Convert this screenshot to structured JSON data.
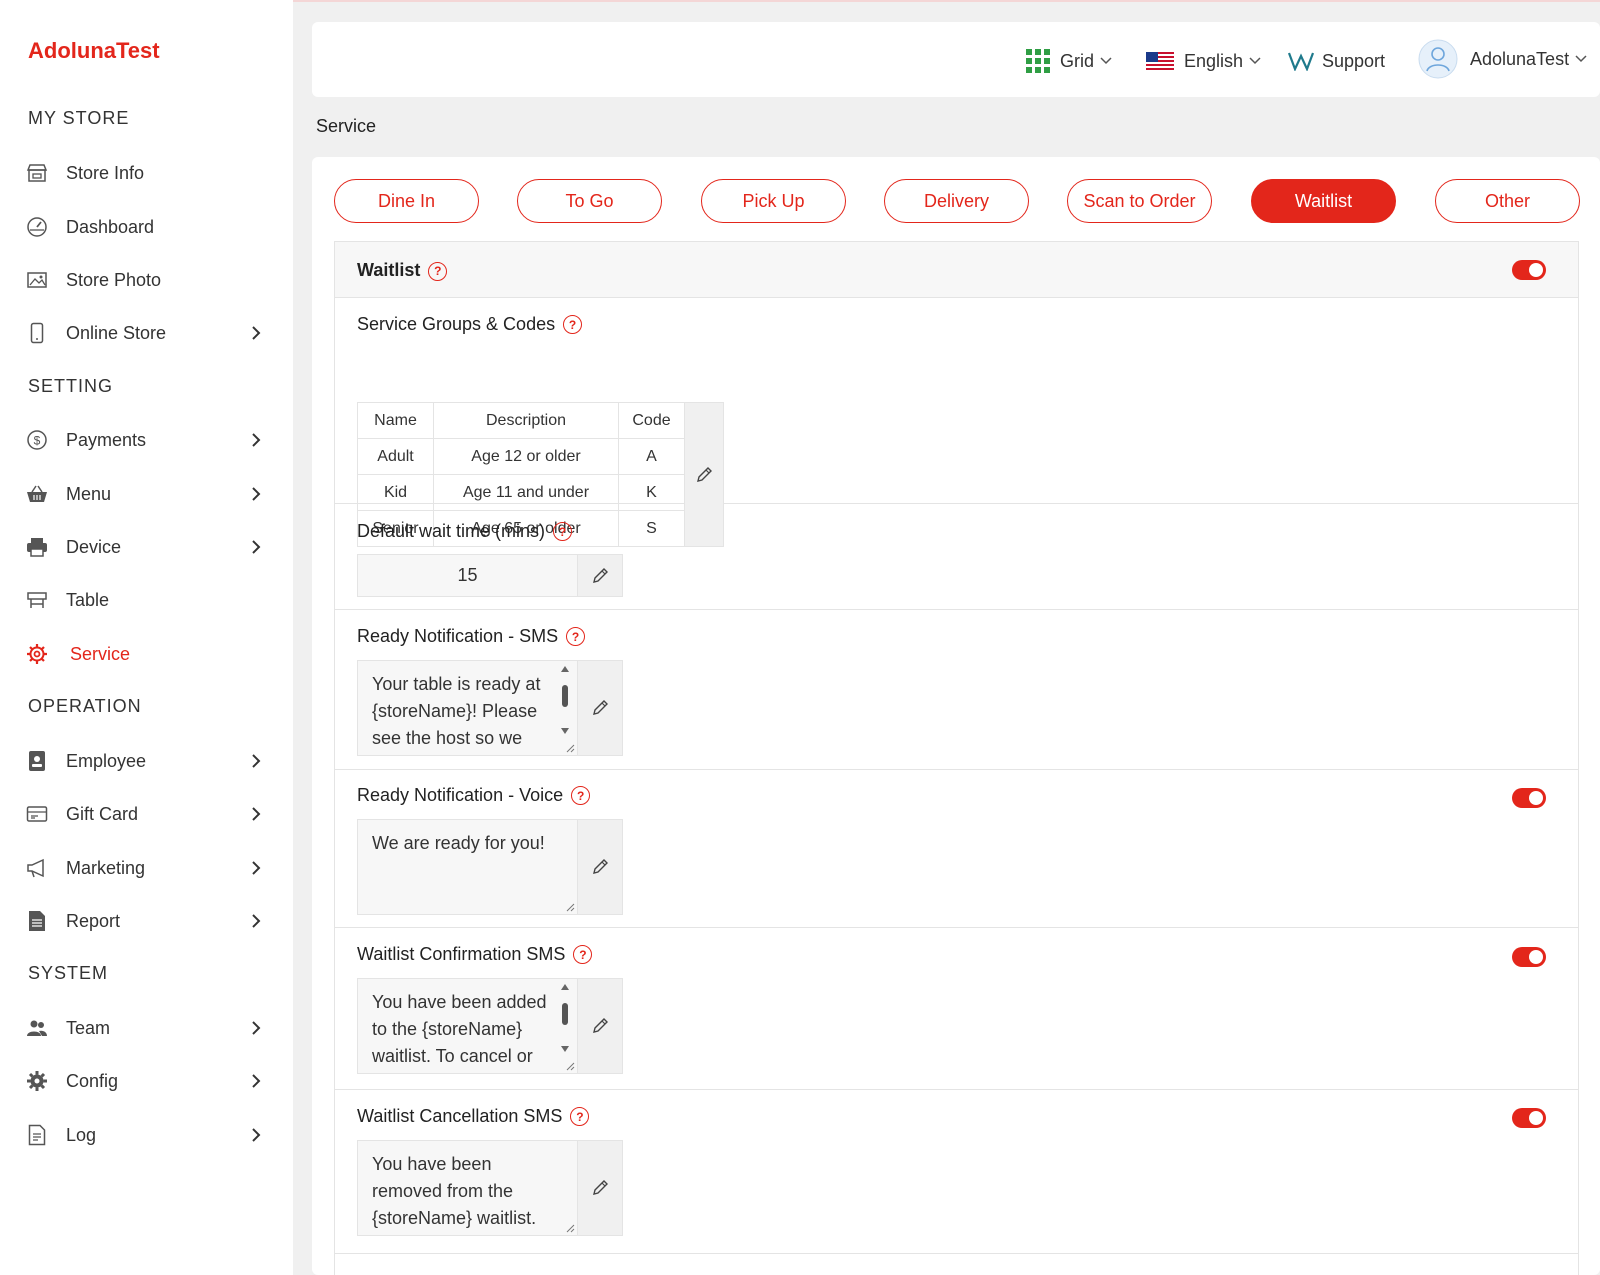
{
  "brand": "AdolunaTest",
  "sidebar": {
    "sections": [
      "MY STORE",
      "SETTING",
      "OPERATION",
      "SYSTEM"
    ],
    "items": [
      {
        "label": "Store Info",
        "icon": "store-icon"
      },
      {
        "label": "Dashboard",
        "icon": "dashboard-icon"
      },
      {
        "label": "Store Photo",
        "icon": "photo-icon"
      },
      {
        "label": "Online Store",
        "icon": "mobile-icon"
      },
      {
        "label": "Payments",
        "icon": "dollar-icon"
      },
      {
        "label": "Menu",
        "icon": "basket-icon"
      },
      {
        "label": "Device",
        "icon": "printer-icon"
      },
      {
        "label": "Table",
        "icon": "table-icon"
      },
      {
        "label": "Service",
        "icon": "gear-icon",
        "active": true
      },
      {
        "label": "Employee",
        "icon": "badge-icon"
      },
      {
        "label": "Gift Card",
        "icon": "giftcard-icon"
      },
      {
        "label": "Marketing",
        "icon": "megaphone-icon"
      },
      {
        "label": "Report",
        "icon": "report-icon"
      },
      {
        "label": "Team",
        "icon": "team-icon"
      },
      {
        "label": "Config",
        "icon": "cog-icon"
      },
      {
        "label": "Log",
        "icon": "log-icon"
      }
    ]
  },
  "topbar": {
    "grid": "Grid",
    "language": "English",
    "support": "Support",
    "user": "AdolunaTest"
  },
  "page_title": "Service",
  "tabs": [
    "Dine In",
    "To Go",
    "Pick Up",
    "Delivery",
    "Scan to Order",
    "Waitlist",
    "Other"
  ],
  "active_tab": "Waitlist",
  "waitlist": {
    "title": "Waitlist",
    "enabled": true,
    "groups_title": "Service Groups & Codes",
    "groups_headers": [
      "Name",
      "Description",
      "Code"
    ],
    "groups_rows": [
      [
        "Adult",
        "Age 12 or older",
        "A"
      ],
      [
        "Kid",
        "Age 11 and under",
        "K"
      ],
      [
        "Senior",
        "Age 65 or older",
        "S"
      ]
    ],
    "wait_time_title": "Default wait time (mins)",
    "wait_time_value": "15",
    "ready_sms_title": "Ready Notification - SMS",
    "ready_sms_text": "Your table is ready at {storeName}! Please see the host so we",
    "ready_voice_title": "Ready Notification - Voice",
    "ready_voice_text": "We are ready for you!",
    "ready_voice_enabled": true,
    "confirm_sms_title": "Waitlist Confirmation SMS",
    "confirm_sms_text": "You have been added to the {storeName} waitlist. To cancel or",
    "confirm_sms_enabled": true,
    "cancel_sms_title": "Waitlist Cancellation SMS",
    "cancel_sms_text": "You have been removed from the {storeName} waitlist.",
    "cancel_sms_enabled": true
  },
  "colors": {
    "accent": "#e3261b"
  }
}
